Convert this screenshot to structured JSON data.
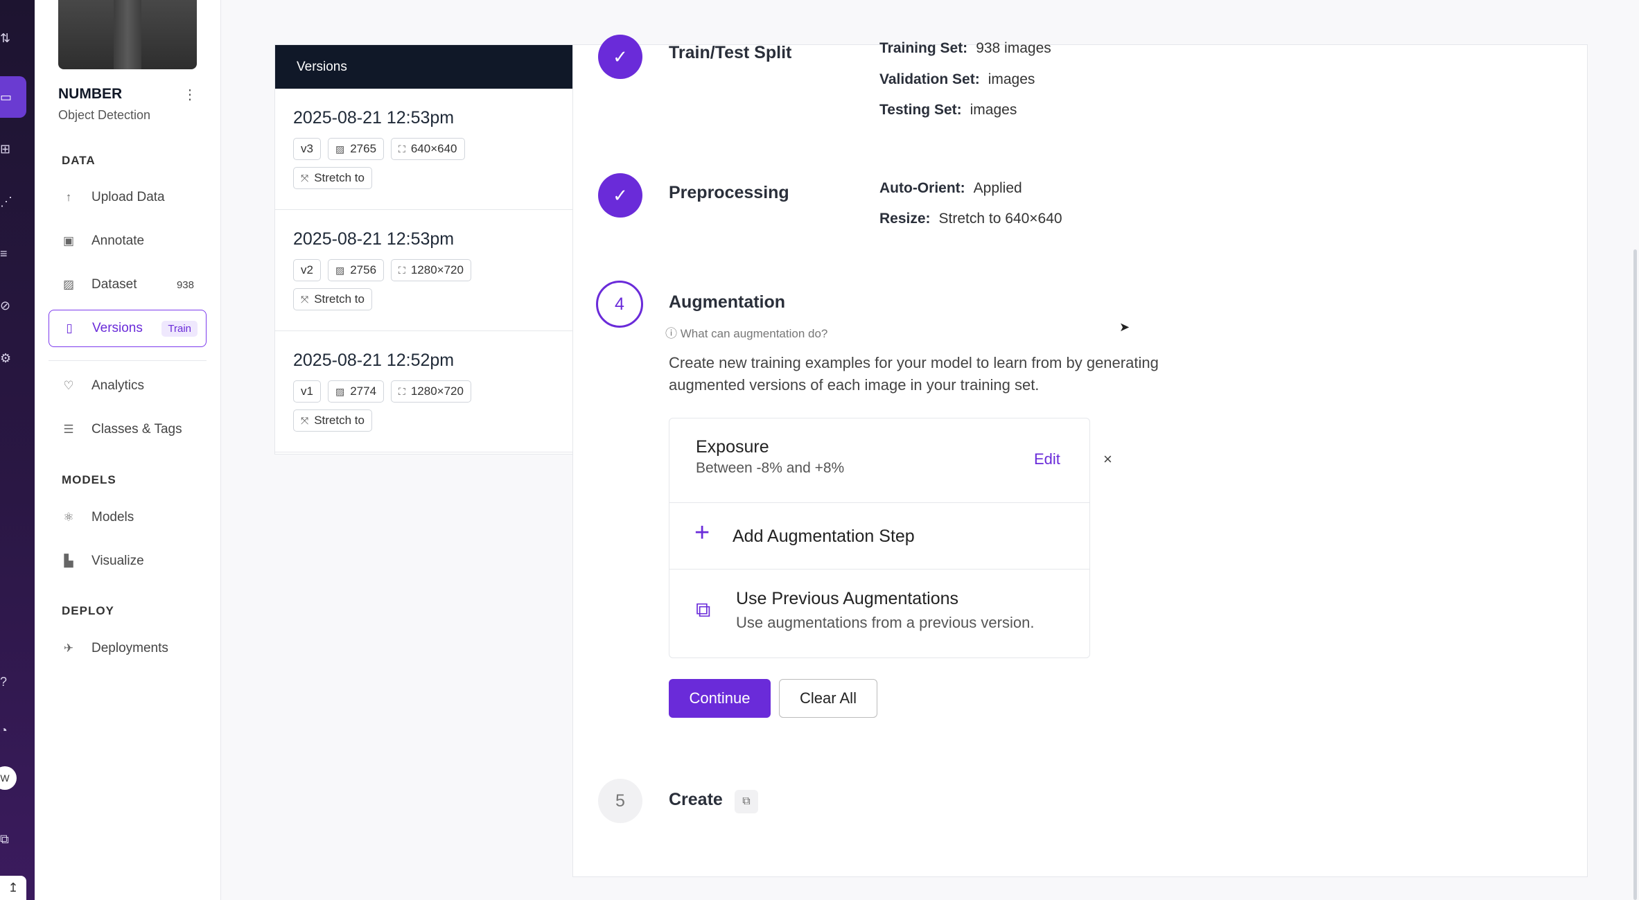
{
  "sidebar": {
    "project_name": "NUMBER",
    "project_type": "Object Detection",
    "sections": {
      "data": "DATA",
      "models": "MODELS",
      "deploy": "DEPLOY"
    },
    "items": {
      "upload": "Upload Data",
      "annotate": "Annotate",
      "dataset": "Dataset",
      "dataset_count": "938",
      "versions": "Versions",
      "versions_tag": "Train",
      "analytics": "Analytics",
      "classes": "Classes & Tags",
      "models": "Models",
      "visualize": "Visualize",
      "deployments": "Deployments"
    },
    "avatar_initial": "W"
  },
  "versions_panel": {
    "header": "Versions",
    "items": [
      {
        "date": "2025-08-21 12:53pm",
        "version": "v3",
        "images": "2765",
        "size": "640×640",
        "resize": "Stretch to"
      },
      {
        "date": "2025-08-21 12:53pm",
        "version": "v2",
        "images": "2756",
        "size": "1280×720",
        "resize": "Stretch to"
      },
      {
        "date": "2025-08-21 12:52pm",
        "version": "v1",
        "images": "2774",
        "size": "1280×720",
        "resize": "Stretch to"
      }
    ]
  },
  "steps": {
    "split": {
      "title": "Train/Test Split",
      "training_label": "Training Set:",
      "training_value": "938 images",
      "validation_label": "Validation Set:",
      "validation_value": "images",
      "testing_label": "Testing Set:",
      "testing_value": "images"
    },
    "preprocessing": {
      "title": "Preprocessing",
      "orient_label": "Auto-Orient:",
      "orient_value": "Applied",
      "resize_label": "Resize:",
      "resize_value": "Stretch to 640×640"
    },
    "augmentation": {
      "number": "4",
      "title": "Augmentation",
      "help": "What can augmentation do?",
      "description": "Create new training examples for your model to learn from by generating augmented versions of each image in your training set.",
      "exposure_title": "Exposure",
      "exposure_range": "Between -8% and +8%",
      "edit_label": "Edit",
      "close_symbol": "×",
      "add_step": "Add Augmentation Step",
      "previous_title": "Use Previous Augmentations",
      "previous_sub": "Use augmentations from a previous version.",
      "continue": "Continue",
      "clear_all": "Clear All"
    },
    "create": {
      "number": "5",
      "title": "Create"
    }
  },
  "colors": {
    "accent": "#6a2bd9",
    "rail": "#2a1744",
    "header_dark": "#101828"
  }
}
